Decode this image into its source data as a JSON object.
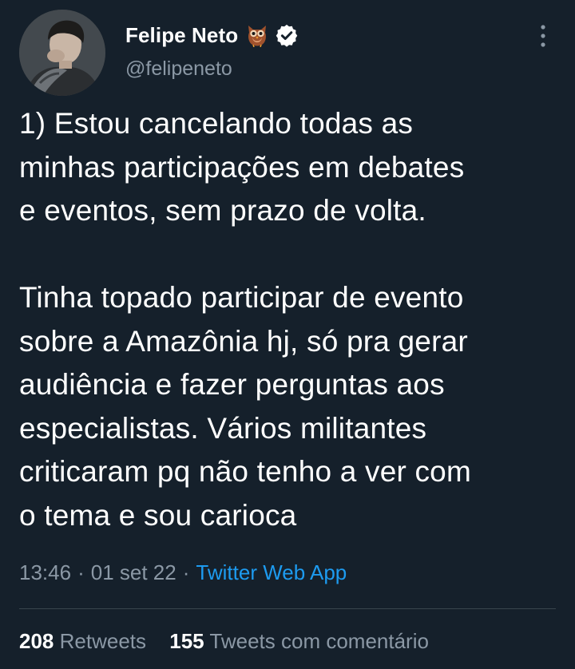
{
  "author": {
    "display_name": "Felipe Neto",
    "handle": "@felipeneto",
    "avatar_icon": "user-avatar",
    "name_emoji_icon": "owl-icon",
    "verified_icon": "verified-badge-icon"
  },
  "menu_icon": "more-vertical-icon",
  "tweet": {
    "paragraphs": [
      {
        "lines": [
          "1) Estou cancelando todas as",
          "minhas participações em debates",
          "e eventos, sem prazo de volta."
        ]
      },
      {
        "lines": [
          "Tinha topado participar de evento",
          "sobre a Amazônia hj, só pra gerar",
          "audiência e fazer perguntas aos",
          "especialistas. Vários militantes",
          "criticaram pq não tenho a ver com",
          "o tema e sou carioca"
        ]
      }
    ],
    "time": "13:46",
    "separator": "·",
    "date": "01 set 22",
    "source": "Twitter Web App"
  },
  "stats": {
    "retweets_count": "208",
    "retweets_label": "Retweets",
    "quotes_count": "155",
    "quotes_label": "Tweets com comentário"
  },
  "colors": {
    "background": "#15202b",
    "text": "#ffffff",
    "secondary": "#8b98a5",
    "link": "#1d9bf0",
    "divider": "#38444d"
  }
}
